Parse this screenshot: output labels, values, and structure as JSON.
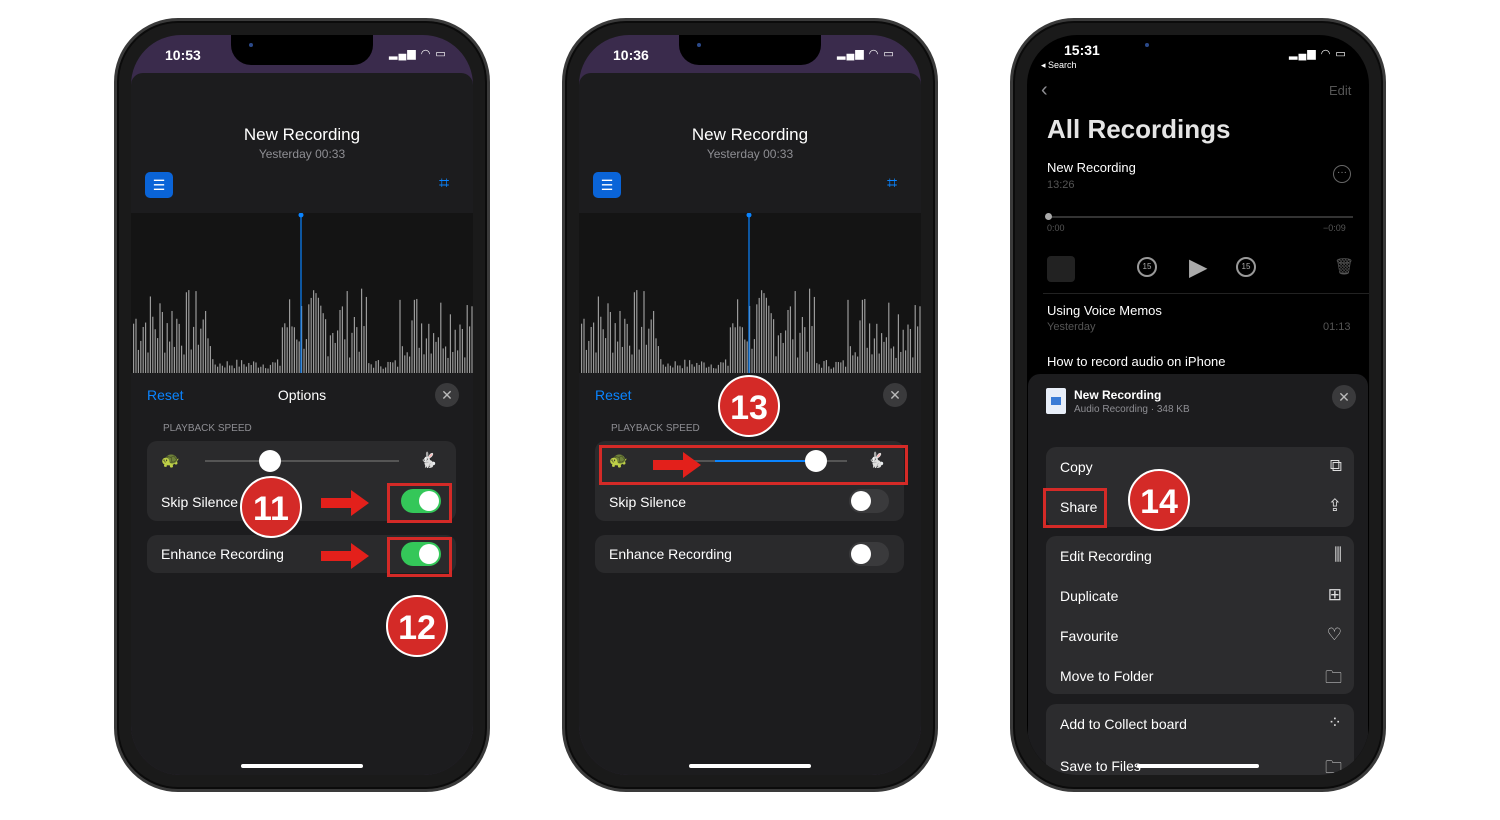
{
  "colors": {
    "accent": "#0a84ff",
    "toggle_on": "#34c759",
    "annotation": "#d42a27",
    "sheet": "#1c1c1e"
  },
  "phone1": {
    "time": "10:53",
    "title": "New Recording",
    "subtitle": "Yesterday  00:33",
    "reset": "Reset",
    "options_title": "Options",
    "section": "PLAYBACK SPEED",
    "speed_level": 0.25,
    "skip_silence": {
      "label": "Skip Silence",
      "on": true
    },
    "enhance": {
      "label": "Enhance Recording",
      "on": true
    },
    "annotations": [
      "11",
      "12"
    ]
  },
  "phone2": {
    "time": "10:36",
    "title": "New Recording",
    "subtitle": "Yesterday  00:33",
    "reset": "Reset",
    "section": "PLAYBACK SPEED",
    "speed_level": 0.75,
    "skip_silence": {
      "label": "Skip Silence",
      "on": false
    },
    "enhance": {
      "label": "Enhance Recording",
      "on": false
    },
    "annotations": [
      "13"
    ]
  },
  "phone3": {
    "time": "15:31",
    "back_app": "◂ Search",
    "edit": "Edit",
    "title": "All Recordings",
    "current": {
      "name": "New Recording",
      "duration": "13:26",
      "elapsed": "0:00",
      "remaining": "−0:09",
      "skip": "15"
    },
    "recordings": [
      {
        "name": "Using Voice Memos",
        "date": "Yesterday",
        "duration": "01:13"
      },
      {
        "name": "How to record audio on iPhone"
      }
    ],
    "share_sheet": {
      "file_name": "New Recording",
      "file_info": "Audio Recording · 348 KB",
      "groups": [
        [
          {
            "label": "Copy",
            "icon": "copy-icon"
          },
          {
            "label": "Share",
            "icon": "share-icon"
          }
        ],
        [
          {
            "label": "Edit Recording",
            "icon": "waveform-icon"
          },
          {
            "label": "Duplicate",
            "icon": "duplicate-icon"
          },
          {
            "label": "Favourite",
            "icon": "heart-icon"
          },
          {
            "label": "Move to Folder",
            "icon": "folder-icon"
          }
        ],
        [
          {
            "label": "Add to Collect board",
            "icon": "collect-icon"
          },
          {
            "label": "Save to Files",
            "icon": "folder-icon"
          }
        ]
      ]
    },
    "annotations": [
      "14"
    ]
  }
}
